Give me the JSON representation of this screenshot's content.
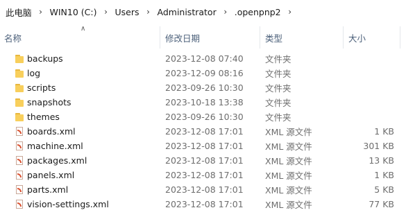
{
  "breadcrumb": [
    {
      "label": "此电脑"
    },
    {
      "label": "WIN10 (C:)"
    },
    {
      "label": "Users"
    },
    {
      "label": "Administrator"
    },
    {
      "label": ".openpnp2"
    }
  ],
  "columns": {
    "name": "名称",
    "date": "修改日期",
    "type": "类型",
    "size": "大小"
  },
  "files": [
    {
      "name": "backups",
      "date": "2023-12-08 07:40",
      "type": "文件夹",
      "size": "",
      "icon": "folder-icon"
    },
    {
      "name": "log",
      "date": "2023-12-09 08:16",
      "type": "文件夹",
      "size": "",
      "icon": "folder-icon"
    },
    {
      "name": "scripts",
      "date": "2023-09-26 10:30",
      "type": "文件夹",
      "size": "",
      "icon": "folder-icon"
    },
    {
      "name": "snapshots",
      "date": "2023-10-18 13:38",
      "type": "文件夹",
      "size": "",
      "icon": "folder-icon"
    },
    {
      "name": "themes",
      "date": "2023-09-26 10:30",
      "type": "文件夹",
      "size": "",
      "icon": "folder-icon"
    },
    {
      "name": "boards.xml",
      "date": "2023-12-08 17:01",
      "type": "XML 源文件",
      "size": "1 KB",
      "icon": "xml-file-icon"
    },
    {
      "name": "machine.xml",
      "date": "2023-12-08 17:01",
      "type": "XML 源文件",
      "size": "301 KB",
      "icon": "xml-file-icon"
    },
    {
      "name": "packages.xml",
      "date": "2023-12-08 17:01",
      "type": "XML 源文件",
      "size": "13 KB",
      "icon": "xml-file-icon"
    },
    {
      "name": "panels.xml",
      "date": "2023-12-08 17:01",
      "type": "XML 源文件",
      "size": "1 KB",
      "icon": "xml-file-icon"
    },
    {
      "name": "parts.xml",
      "date": "2023-12-08 17:01",
      "type": "XML 源文件",
      "size": "5 KB",
      "icon": "xml-file-icon"
    },
    {
      "name": "vision-settings.xml",
      "date": "2023-12-08 17:01",
      "type": "XML 源文件",
      "size": "77 KB",
      "icon": "xml-file-icon"
    }
  ]
}
